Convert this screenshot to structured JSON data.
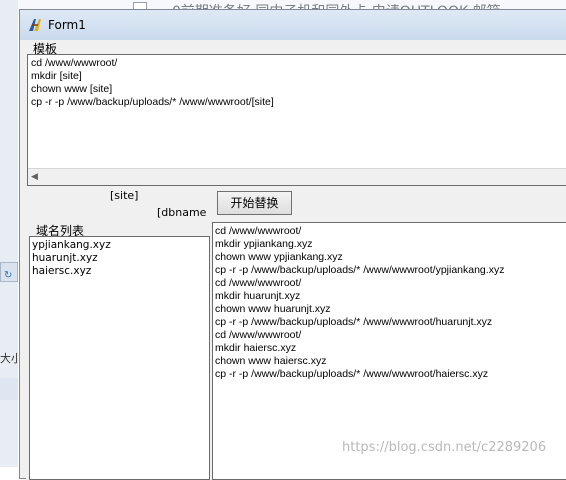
{
  "background": {
    "top_text": "0前期准备好 同中子机和同外卡 申请OUTLOOK 邮箱",
    "left_text": "大小"
  },
  "window": {
    "title": "Form1",
    "template_label": "模板",
    "template_lines": [
      "cd /www/wwwroot/",
      "mkdir [site]",
      "chown www [site]",
      "cp -r -p /www/backup/uploads/* /www/wwwroot/[site]"
    ],
    "site_label": "[site]",
    "dbname_label": "[dbname",
    "start_button": "开始替换",
    "domain_label": "域名列表",
    "domains": [
      "ypjiankang.xyz",
      "huarunjt.xyz",
      "haiersc.xyz"
    ],
    "output_lines": [
      "cd /www/wwwroot/",
      "mkdir ypjiankang.xyz",
      "chown www ypjiankang.xyz",
      "cp -r -p /www/backup/uploads/* /www/wwwroot/ypjiankang.xyz",
      "cd /www/wwwroot/",
      "mkdir huarunjt.xyz",
      "chown www huarunjt.xyz",
      "cp -r -p /www/backup/uploads/* /www/wwwroot/huarunjt.xyz",
      "cd /www/wwwroot/",
      "mkdir haiersc.xyz",
      "chown www haiersc.xyz",
      "cp -r -p /www/backup/uploads/* /www/wwwroot/haiersc.xyz"
    ]
  },
  "watermark": "https://blog.csdn.net/c2289206",
  "colors": {
    "title_bar": "#c9daee",
    "panel_bg": "#ffffff",
    "window_bg": "#f0f0f0"
  }
}
